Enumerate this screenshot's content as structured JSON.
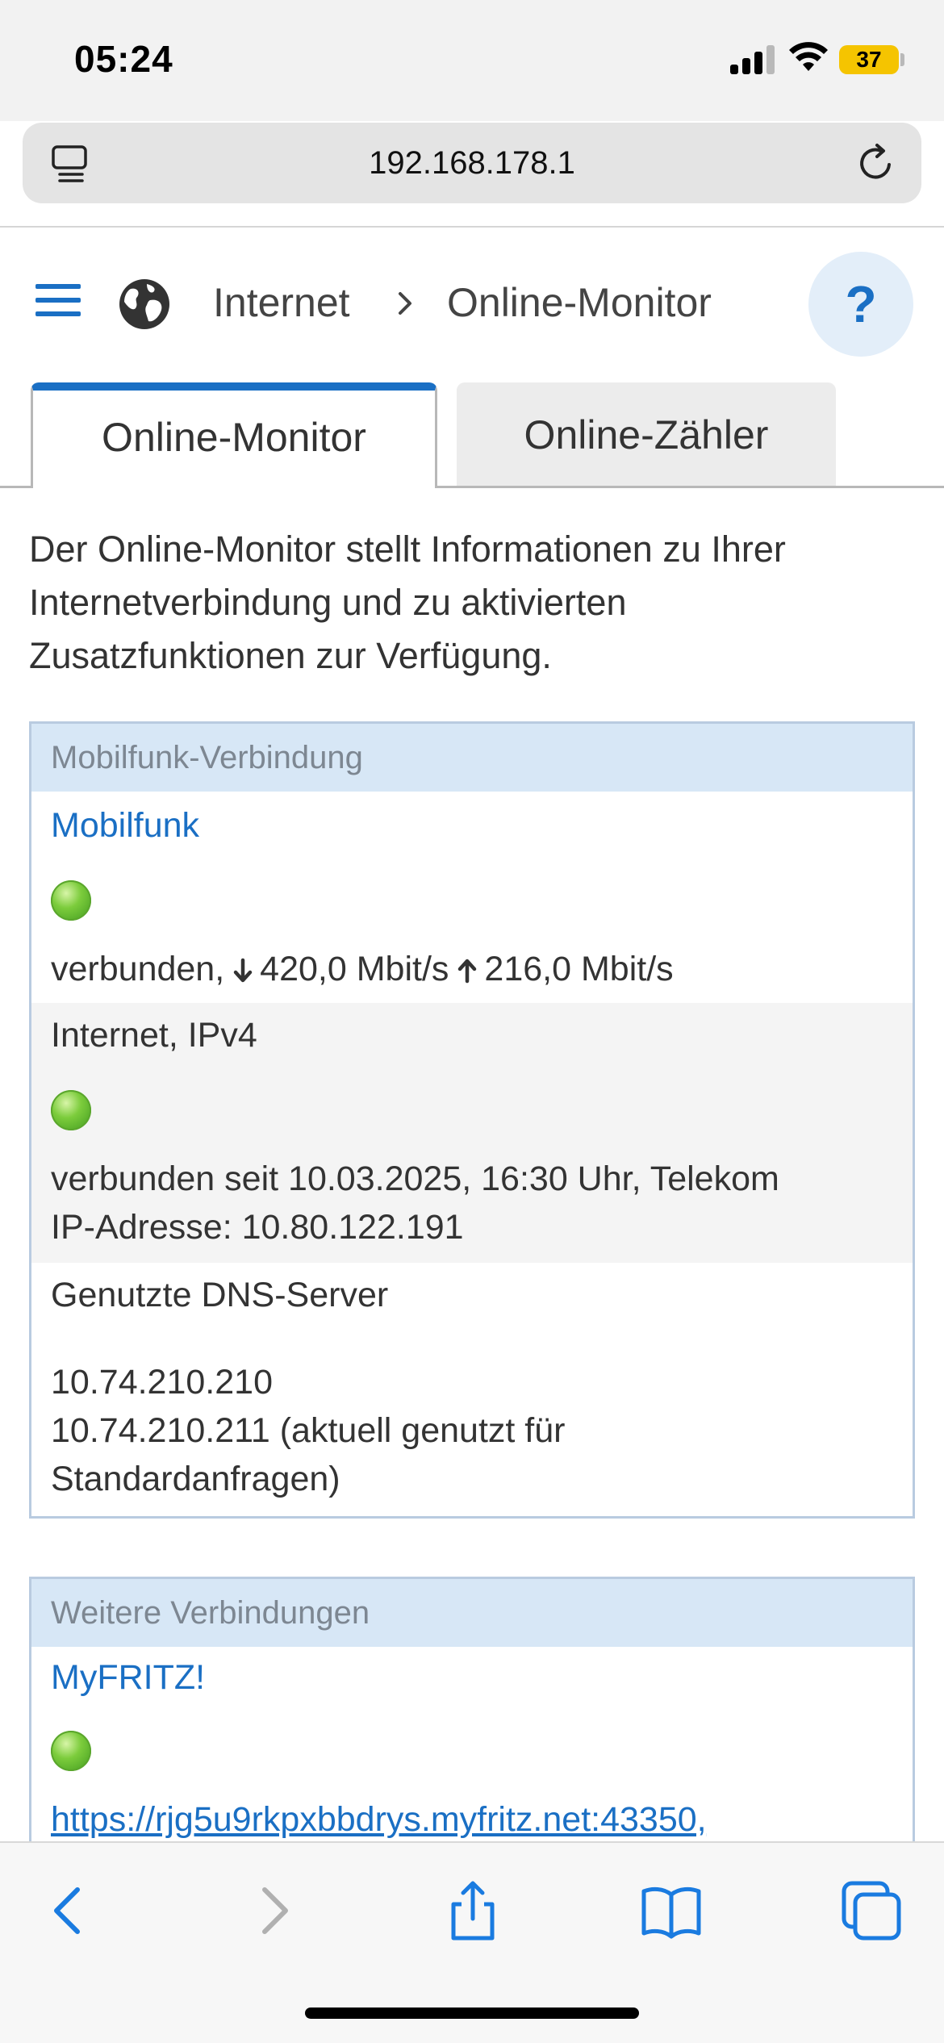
{
  "status": {
    "time": "05:24",
    "battery": "37"
  },
  "browser": {
    "url": "192.168.178.1"
  },
  "header": {
    "crumb1": "Internet",
    "crumb2": "Online-Monitor",
    "help": "?"
  },
  "tabs": [
    {
      "label": "Online-Monitor"
    },
    {
      "label": "Online-Zähler"
    }
  ],
  "intro": "Der Online-Monitor stellt Informationen zu Ihrer Internetverbindung und zu aktivierten Zusatzfunktionen zur Verfügung.",
  "mobile_panel": {
    "title": "Mobilfunk-Verbindung",
    "link": "Mobilfunk",
    "status_prefix": "verbunden,",
    "down": "420,0 Mbit/s",
    "up": "216,0 Mbit/s",
    "ipv4_title": "Internet, IPv4",
    "ipv4_line1": "verbunden seit 10.03.2025, 16:30 Uhr, Telekom",
    "ipv4_line2": "IP-Adresse: 10.80.122.191",
    "dns_title": "Genutzte DNS-Server",
    "dns1": "10.74.210.210",
    "dns2": "10.74.210.211 (aktuell genutzt für",
    "dns2b": "Standardanfragen)"
  },
  "more_panel": {
    "title": "Weitere Verbindungen",
    "link": "MyFRITZ!",
    "url": "https://rjg5u9rkpxbbdrys.myfritz.net:43350,"
  },
  "colors": {
    "accent": "#1a6fc4",
    "panel_head": "#d7e7f6",
    "status_ok": "#5aa62c"
  }
}
